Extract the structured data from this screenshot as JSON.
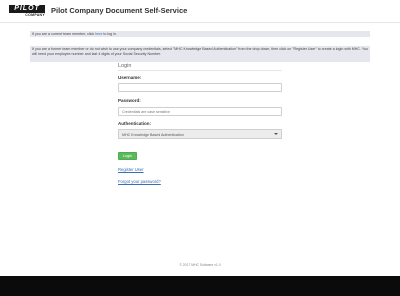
{
  "header": {
    "logo_text": "PILOT",
    "logo_subtext": "COMPANY",
    "title": "Pilot Company Document Self-Service"
  },
  "notices": {
    "current": {
      "prefix": "If you are a current team member, click ",
      "link": "here",
      "suffix": " to log in."
    },
    "former": "If you are a former team member or do not wish to use your company credentials, select \"MHC Knowledge Based Authentication\" from the drop down, then click on \"Register User\" to create a login with MHC. You will need your employee number and last 4 digits of your Social Security Number."
  },
  "login": {
    "title": "Login",
    "username_label": "Username:",
    "username_value": "",
    "password_label": "Password:",
    "password_placeholder": "Credentials are case sensitive",
    "auth_label": "Authentication:",
    "auth_selected": "MHC Knowledge Based Authentication",
    "login_button": "Login",
    "register_link": "Register User",
    "forgot_link": "Forgot your password?"
  },
  "footer": {
    "copyright": "© 2017 MHC Software v1.0"
  },
  "colors": {
    "accent_green": "#5cb85c",
    "link_blue": "#3a6fb5",
    "notice_bg": "#e6e6ee",
    "bottom_bar": "#0b0b0b"
  }
}
